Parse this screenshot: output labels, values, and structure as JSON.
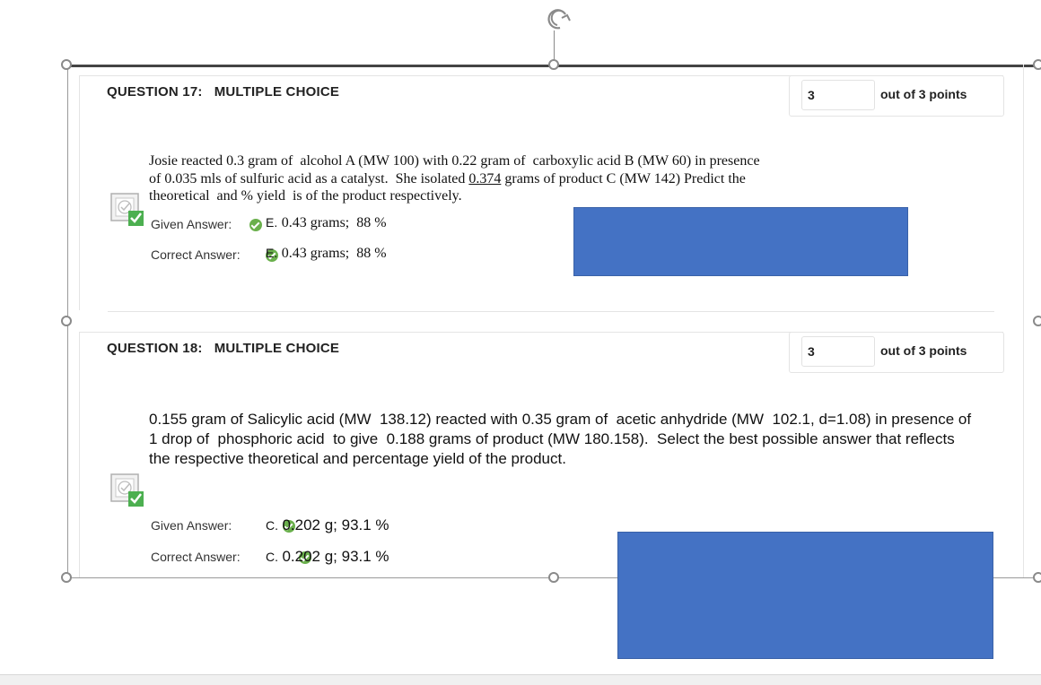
{
  "icons": {
    "rotate": "rotate-handle-icon",
    "graded": "graded-correct-icon",
    "correct": "correct-check-icon"
  },
  "colors": {
    "redaction": "#4472c4",
    "check": "#6ab04c"
  },
  "questions": [
    {
      "header": "QUESTION 17:   MULTIPLE CHOICE",
      "score": "3",
      "score_label": "out of 3 points",
      "text_line1": "Josie reacted 0.3 gram of  alcohol A (MW 100) with 0.22 gram of  carboxylic acid B (MW 60) in presence",
      "text_line2_a": "of 0.035 mls of sulfuric acid as a catalyst.  She isolated ",
      "text_line2_u": "0.374",
      "text_line2_b": " grams of product C (MW 142) Predict the",
      "text_line3": "theoretical  and % yield  is of the product respectively.",
      "given_label": "Given Answer:",
      "given_letter": "E.",
      "given_value": "0.43 grams;  88 %",
      "correct_label": "Correct Answer:",
      "correct_letter": "E.",
      "correct_value": "0.43 grams;  88 %"
    },
    {
      "header": "QUESTION 18:   MULTIPLE CHOICE",
      "score": "3",
      "score_label": "out of 3 points",
      "text_line1": "0.155 gram of Salicylic acid (MW  138.12) reacted with 0.35 gram of  acetic anhydride (MW  102.1, d=1.08) in presence of",
      "text_line2": "1 drop of  phosphoric acid  to give  0.188 grams of product (MW 180.158).  Select the best possible answer that reflects",
      "text_line3": "the respective theoretical and percentage yield of the product.",
      "given_label": "Given Answer:",
      "given_letter": "C.",
      "given_value": "0.202 g; 93.1 %",
      "correct_label": "Correct Answer:",
      "correct_letter": "C.",
      "correct_value": "0.202 g; 93.1 %"
    }
  ]
}
